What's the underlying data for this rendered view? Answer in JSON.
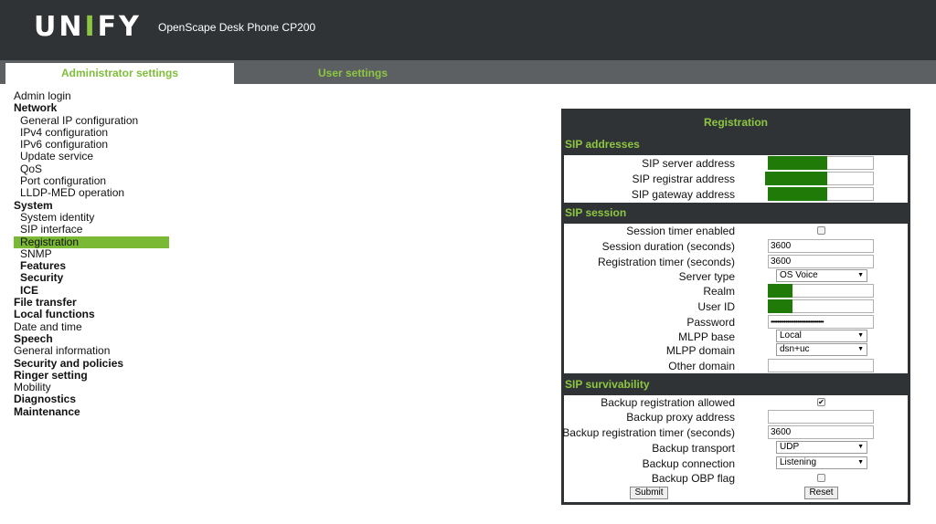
{
  "header": {
    "logo_pre": "UN",
    "logo_accent": "I",
    "logo_post": "FY",
    "product": "OpenScape Desk Phone CP200"
  },
  "tabs": {
    "admin": "Administrator settings",
    "user": "User settings"
  },
  "nav": [
    {
      "label": "Admin login"
    },
    {
      "label": "Network",
      "bold": true
    },
    {
      "label": "General IP configuration",
      "sub": true
    },
    {
      "label": "IPv4 configuration",
      "sub": true
    },
    {
      "label": "IPv6 configuration",
      "sub": true
    },
    {
      "label": "Update service",
      "sub": true
    },
    {
      "label": "QoS",
      "sub": true
    },
    {
      "label": "Port configuration",
      "sub": true
    },
    {
      "label": "LLDP-MED operation",
      "sub": true
    },
    {
      "label": "System",
      "bold": true
    },
    {
      "label": "System identity",
      "sub": true
    },
    {
      "label": "SIP interface",
      "sub": true
    },
    {
      "label": "Registration",
      "sub": true,
      "active": true
    },
    {
      "label": "SNMP",
      "sub": true
    },
    {
      "label": "Features",
      "sub": true,
      "bold": true
    },
    {
      "label": "Security",
      "sub": true,
      "bold": true
    },
    {
      "label": "ICE",
      "sub": true,
      "bold": true
    },
    {
      "label": "File transfer",
      "bold": true
    },
    {
      "label": "Local functions",
      "bold": true
    },
    {
      "label": "Date and time"
    },
    {
      "label": "Speech",
      "bold": true
    },
    {
      "label": "General information"
    },
    {
      "label": "Security and policies",
      "bold": true
    },
    {
      "label": "Ringer setting",
      "bold": true
    },
    {
      "label": "Mobility"
    },
    {
      "label": "Diagnostics",
      "bold": true
    },
    {
      "label": "Maintenance",
      "bold": true
    }
  ],
  "panel": {
    "title": "Registration",
    "sip_addresses": {
      "title": "SIP addresses",
      "server_label": "SIP server address",
      "registrar_label": "SIP registrar address",
      "gateway_label": "SIP gateway address"
    },
    "sip_session": {
      "title": "SIP session",
      "timer_enabled_label": "Session timer enabled",
      "duration_label": "Session duration (seconds)",
      "duration_value": "3600",
      "reg_timer_label": "Registration timer (seconds)",
      "reg_timer_value": "3600",
      "server_type_label": "Server type",
      "server_type_value": "OS Voice",
      "realm_label": "Realm",
      "user_id_label": "User ID",
      "password_label": "Password",
      "password_value": "••••••••••••••••••••••••••••••••",
      "mlpp_base_label": "MLPP base",
      "mlpp_base_value": "Local",
      "mlpp_domain_label": "MLPP domain",
      "mlpp_domain_value": "dsn+uc",
      "other_domain_label": "Other domain"
    },
    "sip_survivability": {
      "title": "SIP survivability",
      "backup_allowed_label": "Backup registration allowed",
      "backup_allowed_mark": "✔",
      "backup_proxy_label": "Backup proxy address",
      "backup_timer_label": "Backup registration timer (seconds)",
      "backup_timer_value": "3600",
      "backup_transport_label": "Backup transport",
      "backup_transport_value": "UDP",
      "backup_connection_label": "Backup connection",
      "backup_connection_value": "Listening",
      "backup_obp_label": "Backup OBP flag"
    },
    "buttons": {
      "submit": "Submit",
      "reset": "Reset"
    }
  },
  "colors": {
    "accent": "#8dc641",
    "header_bg": "#2f3336",
    "active_nav": "#7ab933",
    "redact": "#1f7a07"
  }
}
